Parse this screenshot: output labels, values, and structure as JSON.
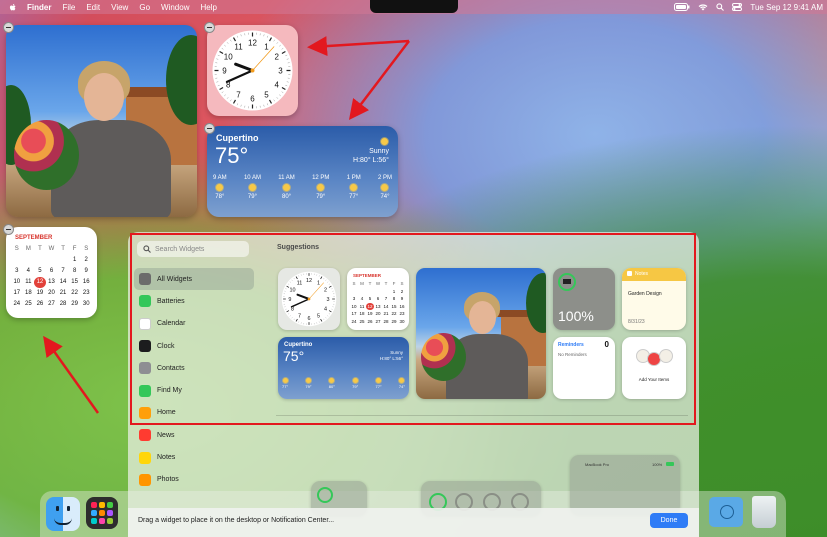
{
  "menubar": {
    "items": [
      "Finder",
      "File",
      "Edit",
      "View",
      "Go",
      "Window",
      "Help"
    ],
    "datetime": "Tue Sep 12  9:41 AM"
  },
  "clock_widget": {
    "hours": [
      12,
      1,
      2,
      3,
      4,
      5,
      6,
      7,
      8,
      9,
      10,
      11
    ]
  },
  "weather_widget": {
    "city": "Cupertino",
    "temp": "75°",
    "condition": "Sunny",
    "hilo": "H:80° L:56°",
    "hours": [
      {
        "time": "9 AM",
        "temp": "78°"
      },
      {
        "time": "10 AM",
        "temp": "79°"
      },
      {
        "time": "11 AM",
        "temp": "80°"
      },
      {
        "time": "12 PM",
        "temp": "79°"
      },
      {
        "time": "1 PM",
        "temp": "77°"
      },
      {
        "time": "2 PM",
        "temp": "74°"
      }
    ]
  },
  "calendar_widget": {
    "month": "SEPTEMBER",
    "weekdays": [
      "S",
      "M",
      "T",
      "W",
      "T",
      "F",
      "S"
    ],
    "days": [
      "",
      "",
      "",
      "",
      "",
      "1",
      "2",
      "3",
      "4",
      "5",
      "6",
      "7",
      "8",
      "9",
      "10",
      "11",
      "12",
      "13",
      "14",
      "15",
      "16",
      "17",
      "18",
      "19",
      "20",
      "21",
      "22",
      "23",
      "24",
      "25",
      "26",
      "27",
      "28",
      "29",
      "30"
    ],
    "today": "12"
  },
  "gallery": {
    "search_placeholder": "Search Widgets",
    "sidebar": [
      {
        "label": "All Widgets",
        "icon": "grid-icon",
        "color": "#6b6b6b"
      },
      {
        "label": "Batteries",
        "icon": "battery-icon",
        "color": "#34c759"
      },
      {
        "label": "Calendar",
        "icon": "calendar-icon",
        "color": "#ffffff"
      },
      {
        "label": "Clock",
        "icon": "clock-icon",
        "color": "#1c1c1e"
      },
      {
        "label": "Contacts",
        "icon": "contacts-icon",
        "color": "#8e8e93"
      },
      {
        "label": "Find My",
        "icon": "findmy-icon",
        "color": "#34c759"
      },
      {
        "label": "Home",
        "icon": "home-icon",
        "color": "#ff9f0a"
      },
      {
        "label": "News",
        "icon": "news-icon",
        "color": "#ff3b30"
      },
      {
        "label": "Notes",
        "icon": "notes-icon",
        "color": "#ffd60a"
      },
      {
        "label": "Photos",
        "icon": "photos-icon",
        "color": "#ff9500"
      }
    ],
    "suggestions_label": "Suggestions",
    "battery_percent": "100%",
    "notes": {
      "title": "Notes",
      "body": "Garden Design",
      "date": "8/31/23"
    },
    "reminders": {
      "title": "Reminders",
      "count": "0",
      "subtitle": "No Reminders"
    },
    "add_items": "Add Your Items",
    "mini_weather": {
      "city": "Cupertino",
      "temp": "75°",
      "condition": "Sunny",
      "hilo": "H:80° L:56°",
      "temps": [
        "77°",
        "79°",
        "80°",
        "79°",
        "77°",
        "74°"
      ]
    },
    "mini_calendar": {
      "month": "SEPTEMBER",
      "today": "12"
    },
    "macbook_label": "MacBook Pro",
    "macbook_percent": "100%",
    "footer_text": "Drag a widget to place it on the desktop or Notification Center...",
    "done_label": "Done"
  }
}
